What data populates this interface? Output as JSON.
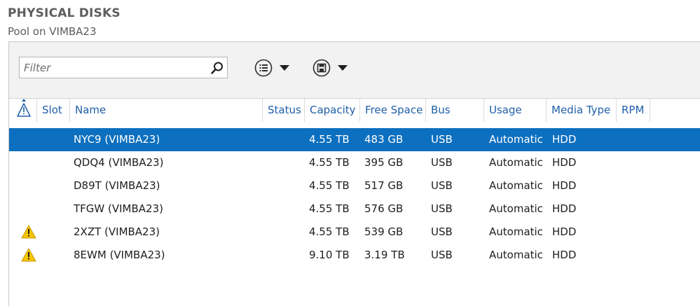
{
  "header": {
    "title": "PHYSICAL DISKS",
    "subtitle": "Pool on VIMBA23"
  },
  "toolbar": {
    "filter_placeholder": "Filter",
    "filter_value": "",
    "search_icon": "search-icon",
    "view_button_icon": "list-view-icon",
    "save_button_icon": "save-icon"
  },
  "columns": [
    {
      "key": "warning",
      "label": ""
    },
    {
      "key": "slot",
      "label": "Slot"
    },
    {
      "key": "name",
      "label": "Name"
    },
    {
      "key": "status",
      "label": "Status"
    },
    {
      "key": "capacity",
      "label": "Capacity"
    },
    {
      "key": "free_space",
      "label": "Free Space"
    },
    {
      "key": "bus",
      "label": "Bus"
    },
    {
      "key": "usage",
      "label": "Usage"
    },
    {
      "key": "media_type",
      "label": "Media Type"
    },
    {
      "key": "rpm",
      "label": "RPM"
    }
  ],
  "rows": [
    {
      "warning": false,
      "name": "NYC9 (VIMBA23)",
      "capacity": "4.55 TB",
      "free_space": "483 GB",
      "bus": "USB",
      "usage": "Automatic",
      "media_type": "HDD",
      "selected": true
    },
    {
      "warning": false,
      "name": "QDQ4 (VIMBA23)",
      "capacity": "4.55 TB",
      "free_space": "395 GB",
      "bus": "USB",
      "usage": "Automatic",
      "media_type": "HDD",
      "selected": false
    },
    {
      "warning": false,
      "name": "D89T (VIMBA23)",
      "capacity": "4.55 TB",
      "free_space": "517 GB",
      "bus": "USB",
      "usage": "Automatic",
      "media_type": "HDD",
      "selected": false
    },
    {
      "warning": false,
      "name": "TFGW (VIMBA23)",
      "capacity": "4.55 TB",
      "free_space": "576 GB",
      "bus": "USB",
      "usage": "Automatic",
      "media_type": "HDD",
      "selected": false
    },
    {
      "warning": true,
      "name": "2XZT (VIMBA23)",
      "capacity": "4.55 TB",
      "free_space": "539 GB",
      "bus": "USB",
      "usage": "Automatic",
      "media_type": "HDD",
      "selected": false
    },
    {
      "warning": true,
      "name": "8EWM (VIMBA23)",
      "capacity": "9.10 TB",
      "free_space": "3.19 TB",
      "bus": "USB",
      "usage": "Automatic",
      "media_type": "HDD",
      "selected": false
    }
  ],
  "colors": {
    "selection": "#0c6fbf",
    "header_text": "#1f5fa8",
    "warning": "#f5c400"
  }
}
